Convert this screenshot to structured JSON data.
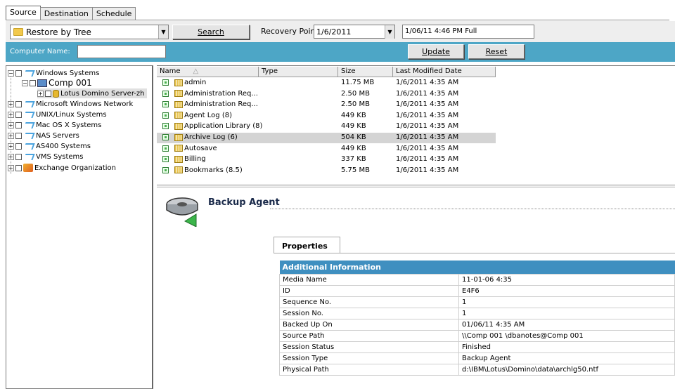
{
  "tabs": [
    "Source",
    "Destination",
    "Schedule"
  ],
  "toolbar": {
    "restore_mode": "Restore by Tree",
    "search_label": "Search",
    "recovery_point_label": "Recovery Point:",
    "recovery_point_value": "1/6/2011",
    "recovery_point_detail": "1/06/11 4:46 PM  Full"
  },
  "filter": {
    "computer_name_label": "Computer Name:",
    "computer_name_value": "",
    "update_label": "Update",
    "reset_label": "Reset"
  },
  "tree": {
    "nodes": [
      {
        "label": "Windows Systems",
        "icon": "network-icon"
      },
      {
        "label": "Comp 001",
        "icon": "computer-icon"
      },
      {
        "label": "Lotus Domino Server-zh",
        "icon": "database-icon"
      },
      {
        "label": "Microsoft Windows Network",
        "icon": "network-icon"
      },
      {
        "label": "UNIX/Linux Systems",
        "icon": "network-icon"
      },
      {
        "label": "Mac OS X Systems",
        "icon": "network-icon"
      },
      {
        "label": "NAS Servers",
        "icon": "network-icon"
      },
      {
        "label": "AS400 Systems",
        "icon": "network-icon"
      },
      {
        "label": "VMS Systems",
        "icon": "network-icon"
      },
      {
        "label": "Exchange Organization",
        "icon": "exchange-icon"
      }
    ]
  },
  "file_list": {
    "columns": [
      "Name",
      "Type",
      "Size",
      "Last Modified Date"
    ],
    "rows": [
      {
        "name": "admin",
        "type": "",
        "size": "11.75 MB",
        "date": "1/6/2011 4:35 AM"
      },
      {
        "name": "Administration Req...",
        "type": "",
        "size": "2.50 MB",
        "date": "1/6/2011 4:35 AM"
      },
      {
        "name": "Administration Req...",
        "type": "",
        "size": "2.50 MB",
        "date": "1/6/2011 4:35 AM"
      },
      {
        "name": "Agent Log (8)",
        "type": "",
        "size": "449 KB",
        "date": "1/6/2011 4:35 AM"
      },
      {
        "name": "Application Library (8)",
        "type": "",
        "size": "449 KB",
        "date": "1/6/2011 4:35 AM"
      },
      {
        "name": "Archive Log (6)",
        "type": "",
        "size": "504 KB",
        "date": "1/6/2011 4:35 AM"
      },
      {
        "name": "Autosave",
        "type": "",
        "size": "449 KB",
        "date": "1/6/2011 4:35 AM"
      },
      {
        "name": "Billing",
        "type": "",
        "size": "337 KB",
        "date": "1/6/2011 4:35 AM"
      },
      {
        "name": "Bookmarks (8.5)",
        "type": "",
        "size": "5.75 MB",
        "date": "1/6/2011 4:35 AM"
      }
    ]
  },
  "detail": {
    "title": "Backup Agent",
    "properties_tab": "Properties",
    "section_title": "Additional Information",
    "rows": [
      {
        "key": "Media Name",
        "value": "11-01-06 4:35"
      },
      {
        "key": "ID",
        "value": "E4F6"
      },
      {
        "key": "Sequence No.",
        "value": "1"
      },
      {
        "key": "Session No.",
        "value": "1"
      },
      {
        "key": "Backed Up On",
        "value": "01/06/11 4:35 AM"
      },
      {
        "key": "Source Path",
        "value": "\\\\Comp 001       \\dbanotes@Comp 001"
      },
      {
        "key": "Session Status",
        "value": "Finished"
      },
      {
        "key": "Session Type",
        "value": "Backup Agent"
      },
      {
        "key": "Physical Path",
        "value": "d:\\IBM\\Lotus\\Domino\\data\\archlg50.ntf"
      }
    ]
  }
}
